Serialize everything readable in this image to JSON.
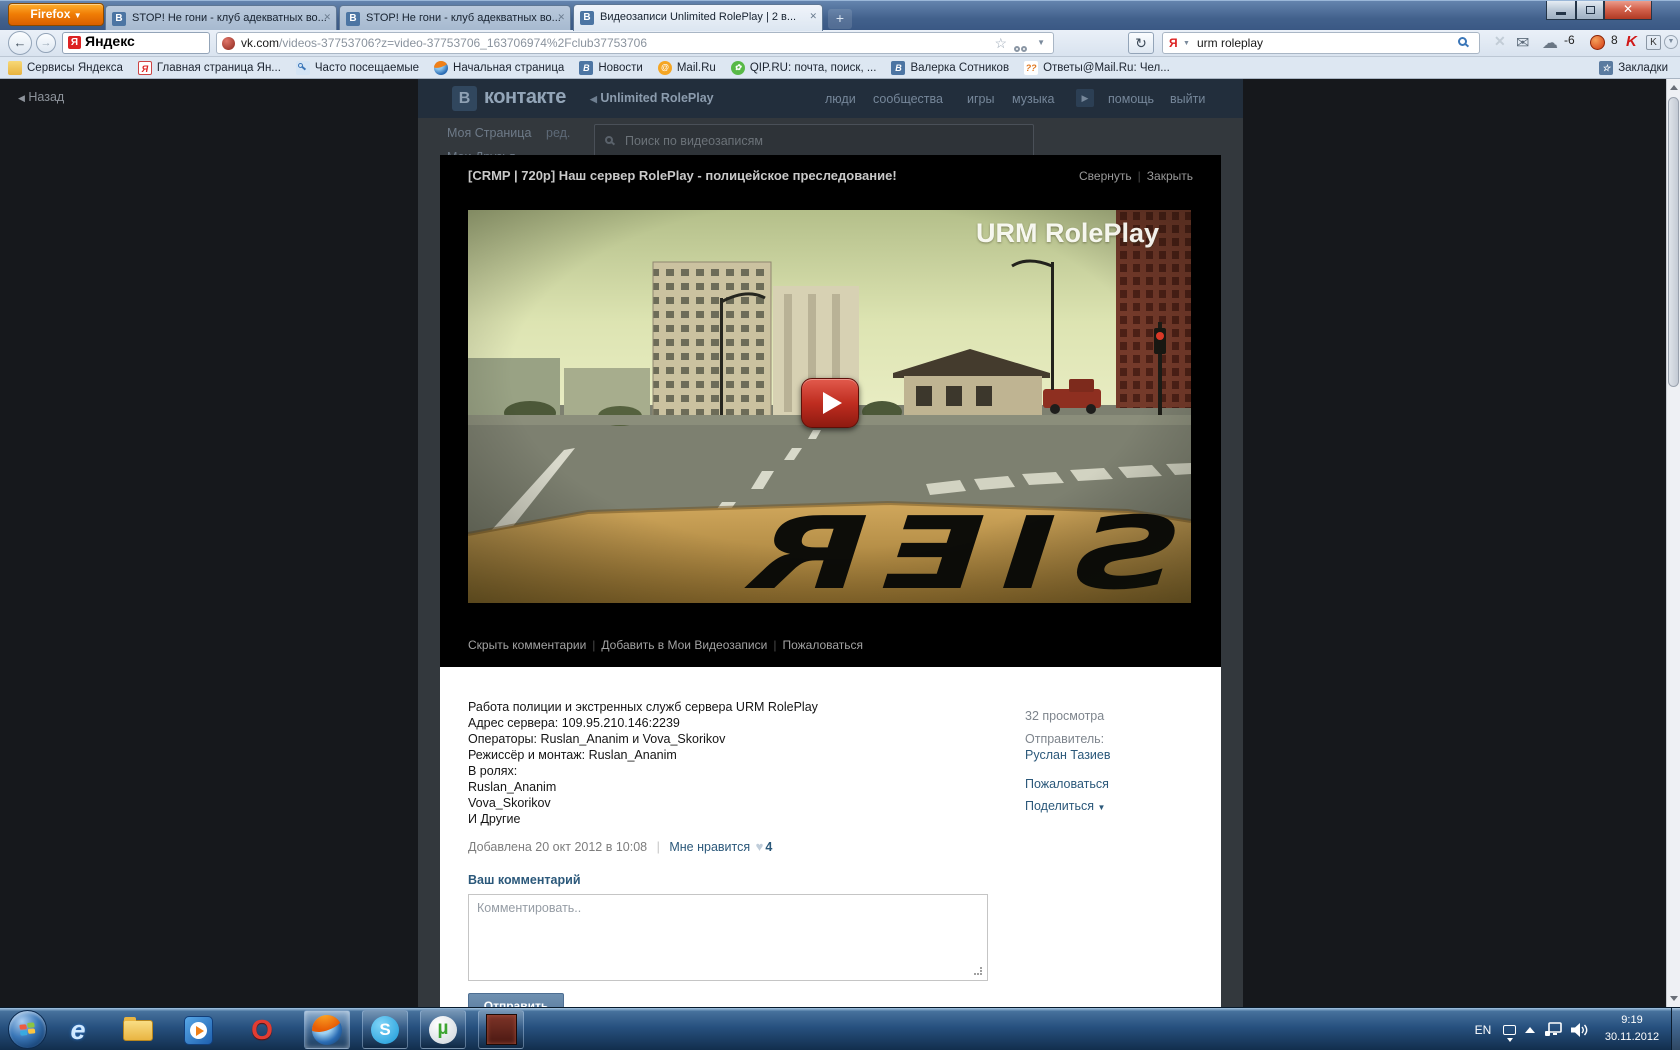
{
  "colors": {
    "vk_blue": "#2b587a",
    "vk_header": "#45688e",
    "play_red": "#c02d20",
    "firefox_orange": "#f07d05",
    "taskbar_blue": "#27517f"
  },
  "glyphs": {
    "vk_letter": "В",
    "yandex_letter": "Я",
    "at": "@",
    "qmarks": "??",
    "k_letter": "K",
    "skype_letter": "S",
    "ie_letter": "e",
    "opera_letter": "O",
    "ut_letter": "µ",
    "caret_down": "▼",
    "arrow_right": "▶",
    "arrow_left": "◀",
    "back_arrow": "←",
    "fwd_arrow": "→",
    "plus": "+",
    "close": "✕",
    "heart": "♥",
    "star": "☆",
    "reload": "↻",
    "envelope": "✉",
    "cloud": "☁",
    "flower": "✿"
  },
  "browser": {
    "app_button": "Firefox",
    "tabs": [
      {
        "icon": "vk-favicon",
        "title": "STOP! Не гони - клуб адекватных во..."
      },
      {
        "icon": "vk-favicon",
        "title": "STOP! Не гони - клуб адекватных во..."
      },
      {
        "icon": "vk-favicon",
        "title": "Видеозаписи Unlimited RolePlay | 2 в..."
      }
    ],
    "yandex_logo": "Яндекс",
    "url_domain": "vk.com",
    "url_rest": "/videos-37753706?z=video-37753706_163706974%2Fclub37753706",
    "search_value": "urm roleplay",
    "addons": {
      "weather_temp": "-6",
      "opera_badge": "8"
    },
    "bookmarks": [
      {
        "icon": "folder-icon",
        "label": "Сервисы Яндекса"
      },
      {
        "icon": "yandex-icon",
        "label": "Главная страница Ян..."
      },
      {
        "icon": "search-icon",
        "label": "Часто посещаемые"
      },
      {
        "icon": "firefox-icon",
        "label": "Начальная страница"
      },
      {
        "icon": "vk-icon",
        "label": "Новости"
      },
      {
        "icon": "mailru-icon",
        "label": "Mail.Ru"
      },
      {
        "icon": "qip-icon",
        "label": "QIP.RU: почта, поиск, ..."
      },
      {
        "icon": "vk-icon",
        "label": "Валерка Сотников"
      },
      {
        "icon": "otvety-icon",
        "label": "Ответы@Mail.Ru: Чел..."
      }
    ],
    "bookmarks_right": "Закладки"
  },
  "vk": {
    "logo_letter": "В",
    "logo_text": "контакте",
    "group_name": "Unlimited RolePlay",
    "nav": [
      "люди",
      "сообщества",
      "игры",
      "музыка"
    ],
    "nav2": [
      "помощь",
      "выйти"
    ],
    "back_link": "Назад",
    "sidebar": {
      "my_page": "Моя Страница",
      "edit": "ред.",
      "my_friends": "Мои Друзья"
    },
    "video_search_placeholder": "Поиск по видеозаписям"
  },
  "modal": {
    "title": "[CRMP | 720p] Наш сервер RolePlay - полицейское преследование!",
    "collapse": "Свернуть",
    "close": "Закрыть",
    "watermark": "URM RolePlay",
    "actions": [
      "Скрыть комментарии",
      "Добавить в Мои Видеозаписи",
      "Пожаловаться"
    ],
    "description_lines": [
      "Работа полиции и экстренных служб сервера URM RolePlay",
      "Адрес сервера: 109.95.210.146:2239",
      "Операторы: Ruslan_Ananim и Vova_Skorikov",
      "Режиссёр и монтаж: Ruslan_Ananim",
      "В ролях:",
      "Ruslan_Ananim",
      "Vova_Skorikov",
      "И Другие"
    ],
    "added": "Добавлена 20 окт 2012 в 10:08",
    "like_label": "Мне нравится",
    "like_count": "4",
    "views": "32 просмотра",
    "sender_label": "Отправитель:",
    "sender_name": "Руслан Тазиев",
    "report": "Пожаловаться",
    "share": "Поделиться",
    "comment_heading": "Ваш комментарий",
    "comment_placeholder": "Комментировать..",
    "submit": "Отправить"
  },
  "taskbar": {
    "lang": "EN",
    "time": "9:19",
    "date": "30.11.2012"
  }
}
